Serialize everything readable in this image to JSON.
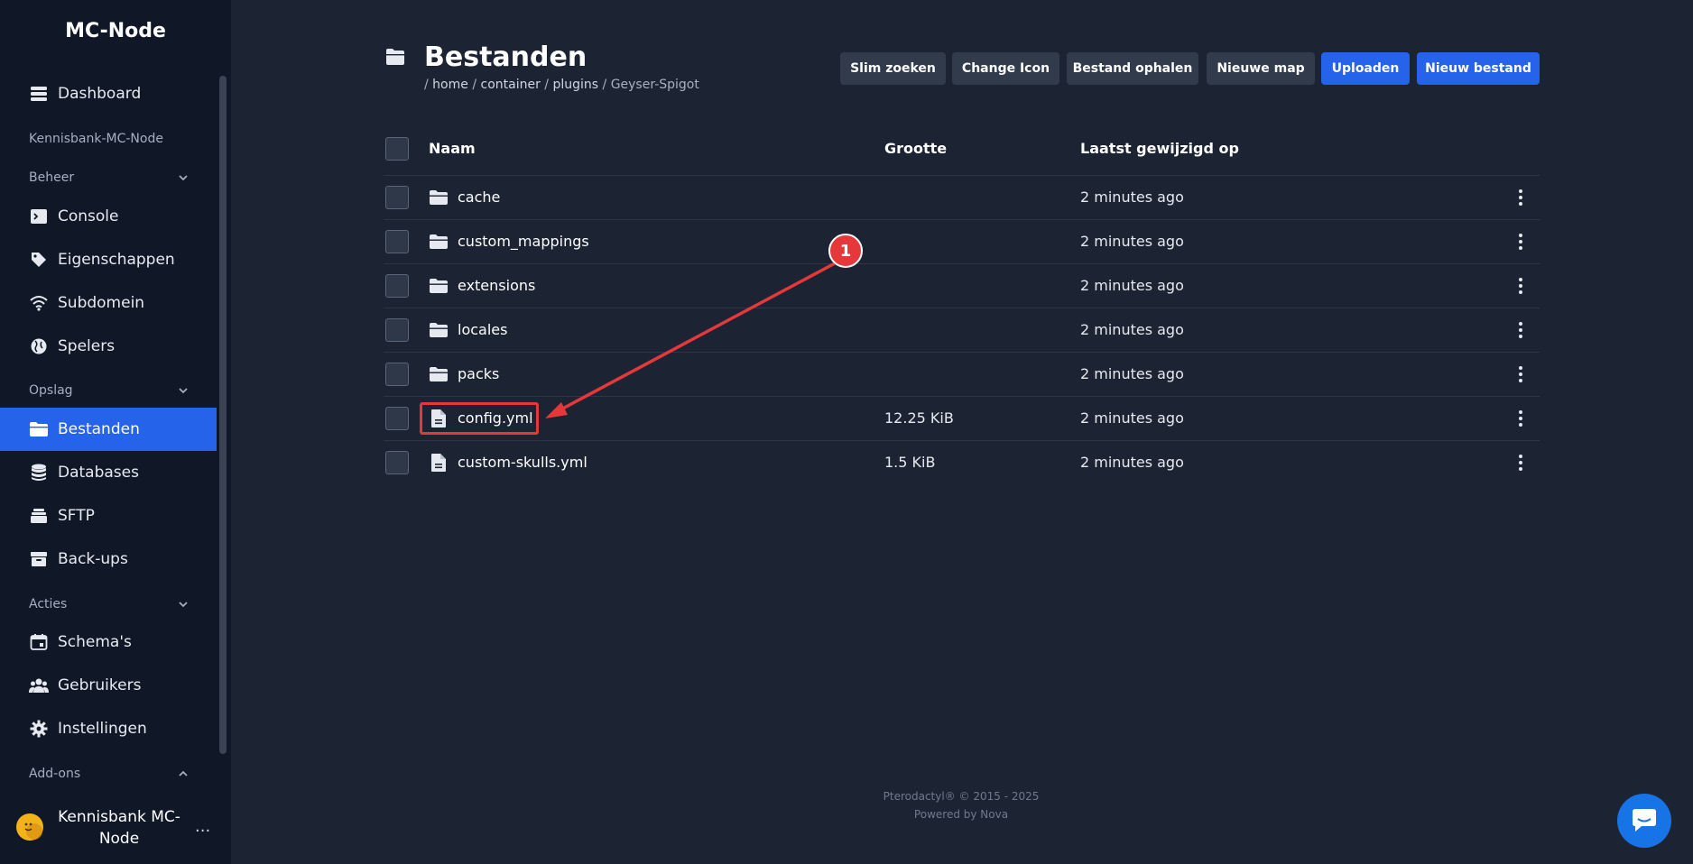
{
  "app": {
    "brand": "MC-Node"
  },
  "sidebar": {
    "items": [
      {
        "label": "Dashboard",
        "icon": "server-stack-icon"
      },
      {
        "label": "Console",
        "icon": "terminal-icon"
      },
      {
        "label": "Eigenschappen",
        "icon": "tag-icon"
      },
      {
        "label": "Subdomein",
        "icon": "wifi-icon"
      },
      {
        "label": "Spelers",
        "icon": "globe-icon"
      },
      {
        "label": "Bestanden",
        "icon": "folder-icon",
        "active": true
      },
      {
        "label": "Databases",
        "icon": "database-icon"
      },
      {
        "label": "SFTP",
        "icon": "stack-icon"
      },
      {
        "label": "Back-ups",
        "icon": "archive-icon"
      },
      {
        "label": "Schema's",
        "icon": "calendar-icon"
      },
      {
        "label": "Gebruikers",
        "icon": "users-icon"
      },
      {
        "label": "Instellingen",
        "icon": "gear-icon"
      }
    ],
    "sections": {
      "server": "Kennisbank-MC-Node",
      "beheer": "Beheer",
      "opslag": "Opslag",
      "acties": "Acties",
      "addons": "Add-ons"
    },
    "user": {
      "name": "Kennisbank MC-Node",
      "menu": "..."
    }
  },
  "header": {
    "title": "Bestanden",
    "breadcrumb": [
      "home",
      "container",
      "plugins",
      "Geyser-Spigot"
    ],
    "sep": "/"
  },
  "toolbar": {
    "smart_search": "Slim zoeken",
    "change_icon": "Change Icon",
    "fetch_file": "Bestand ophalen",
    "new_folder": "Nieuwe map",
    "upload": "Uploaden",
    "new_file": "Nieuw bestand"
  },
  "table": {
    "columns": {
      "name": "Naam",
      "size": "Grootte",
      "modified": "Laatst gewijzigd op"
    },
    "rows": [
      {
        "name": "cache",
        "type": "folder",
        "size": "",
        "modified": "2 minutes ago"
      },
      {
        "name": "custom_mappings",
        "type": "folder",
        "size": "",
        "modified": "2 minutes ago"
      },
      {
        "name": "extensions",
        "type": "folder",
        "size": "",
        "modified": "2 minutes ago"
      },
      {
        "name": "locales",
        "type": "folder",
        "size": "",
        "modified": "2 minutes ago"
      },
      {
        "name": "packs",
        "type": "folder",
        "size": "",
        "modified": "2 minutes ago"
      },
      {
        "name": "config.yml",
        "type": "file",
        "size": "12.25 KiB",
        "modified": "2 minutes ago"
      },
      {
        "name": "custom-skulls.yml",
        "type": "file",
        "size": "1.5 KiB",
        "modified": "2 minutes ago"
      }
    ]
  },
  "annotation": {
    "marker": "1"
  },
  "footer": {
    "line1": "Pterodactyl® © 2015 - 2025",
    "line2": "Powered by Nova"
  },
  "colors": {
    "accent": "#2563eb",
    "annotation": "#e5383b",
    "background": "#1c2433",
    "sidebar": "#101828"
  }
}
